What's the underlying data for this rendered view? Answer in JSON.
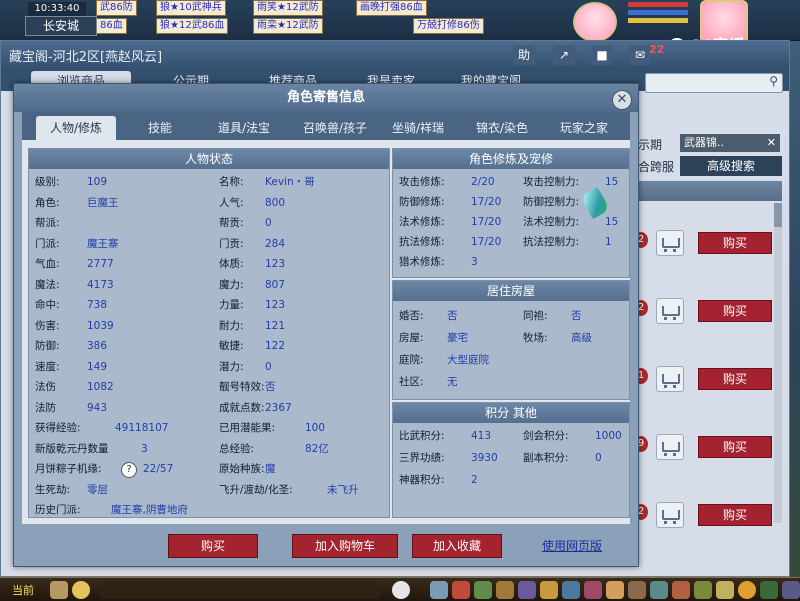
{
  "hud": {
    "time": "10:33:40",
    "location": "长安城",
    "top_chips": [
      "武86防",
      "狼★10武神兵",
      "雨笑★12武防",
      "画晚打强86血",
      "86血",
      "狼★12武86血",
      "雨栾★12武防",
      "万兢打修86伤"
    ],
    "cc_logo": "CC直播"
  },
  "main": {
    "title": "藏宝阁-河北2区[燕赵风云]",
    "notif_count": "22",
    "toolbar": {
      "help": "助"
    },
    "tabs": [
      "浏览商品",
      "公示期",
      "推荐商品",
      "我是卖家",
      "我的藏宝阁"
    ],
    "right": {
      "label_publicity": "示期",
      "weapon_select": "武器锦..",
      "label_cross": "合跨服",
      "adv_search": "高级搜索",
      "buy_label": "购买",
      "row_nums": [
        "2",
        "2",
        "1",
        "9",
        "2"
      ]
    }
  },
  "modal": {
    "title": "角色寄售信息",
    "tabs": [
      "人物/修炼",
      "技能",
      "道具/法宝",
      "召唤兽/孩子",
      "坐骑/祥瑞",
      "锦衣/染色",
      "玩家之家"
    ],
    "status": {
      "header": "人物状态",
      "left": [
        {
          "k": "级别:",
          "v": "109"
        },
        {
          "k": "角色:",
          "v": "巨魔王"
        },
        {
          "k": "帮派:",
          "v": ""
        },
        {
          "k": "门派:",
          "v": "魔王寨"
        },
        {
          "k": "气血:",
          "v": "2777"
        },
        {
          "k": "魔法:",
          "v": "4173"
        },
        {
          "k": "命中:",
          "v": "738"
        },
        {
          "k": "伤害:",
          "v": "1039"
        },
        {
          "k": "防御:",
          "v": "386"
        },
        {
          "k": "速度:",
          "v": "149"
        },
        {
          "k": "法伤",
          "v": "1082"
        },
        {
          "k": "法防",
          "v": "943"
        },
        {
          "k": "获得经验:",
          "v": "49118107"
        },
        {
          "k": "新版乾元丹数量",
          "v": "3"
        },
        {
          "k": "月饼粽子机缘:",
          "v": "22/57"
        },
        {
          "k": "生死劫:",
          "v": "零层"
        },
        {
          "k": "历史门派:",
          "v": "魔王寨,阴曹地府"
        }
      ],
      "right": [
        {
          "k": "名称:",
          "v": "Kevin・哥"
        },
        {
          "k": "人气:",
          "v": "800"
        },
        {
          "k": "帮贡:",
          "v": "0"
        },
        {
          "k": "门贡:",
          "v": "284"
        },
        {
          "k": "体质:",
          "v": "123"
        },
        {
          "k": "魔力:",
          "v": "807"
        },
        {
          "k": "力量:",
          "v": "123"
        },
        {
          "k": "耐力:",
          "v": "121"
        },
        {
          "k": "敏捷:",
          "v": "122"
        },
        {
          "k": "潜力:",
          "v": "0"
        },
        {
          "k": "靓号特效:",
          "v": "否"
        },
        {
          "k": "成就点数:",
          "v": "2367"
        },
        {
          "k": "已用潜能果:",
          "v": "100"
        },
        {
          "k": "总经验:",
          "v": "82亿"
        },
        {
          "k": "原始种族:",
          "v": "魔"
        },
        {
          "k": "飞升/渡劫/化圣:",
          "v": "未飞升"
        }
      ]
    },
    "cultivation": {
      "header": "角色修炼及宠修",
      "left": [
        {
          "k": "攻击修炼:",
          "v": "2/20"
        },
        {
          "k": "防御修炼:",
          "v": "17/20"
        },
        {
          "k": "法术修炼:",
          "v": "17/20"
        },
        {
          "k": "抗法修炼:",
          "v": "17/20"
        },
        {
          "k": "猎术修炼:",
          "v": "3"
        }
      ],
      "right": [
        {
          "k": "攻击控制力:",
          "v": "15"
        },
        {
          "k": "防御控制力:",
          "v": ""
        },
        {
          "k": "法术控制力:",
          "v": "15"
        },
        {
          "k": "抗法控制力:",
          "v": "1"
        }
      ]
    },
    "house": {
      "header": "居住房屋",
      "left": [
        {
          "k": "婚否:",
          "v": "否"
        },
        {
          "k": "房屋:",
          "v": "豪宅"
        },
        {
          "k": "庭院:",
          "v": "大型庭院"
        },
        {
          "k": "社区:",
          "v": "无"
        }
      ],
      "right": [
        {
          "k": "同袍:",
          "v": "否"
        },
        {
          "k": "牧场:",
          "v": "高级"
        }
      ]
    },
    "points": {
      "header": "积分 其他",
      "left": [
        {
          "k": "比武积分:",
          "v": "413"
        },
        {
          "k": "三界功绩:",
          "v": "3930"
        },
        {
          "k": "神器积分:",
          "v": "2"
        }
      ],
      "right": [
        {
          "k": "剑会积分:",
          "v": "1000"
        },
        {
          "k": "副本积分:",
          "v": "0"
        }
      ]
    },
    "buttons": {
      "buy": "购买",
      "add_cart": "加入购物车",
      "add_fav": "加入收藏",
      "web_version": "使用网页版"
    }
  },
  "bottom": {
    "label": "当前"
  },
  "colors": {
    "accent_red": "#a4222f",
    "header_blue": "#556f8e",
    "value_blue": "#223ea8"
  }
}
